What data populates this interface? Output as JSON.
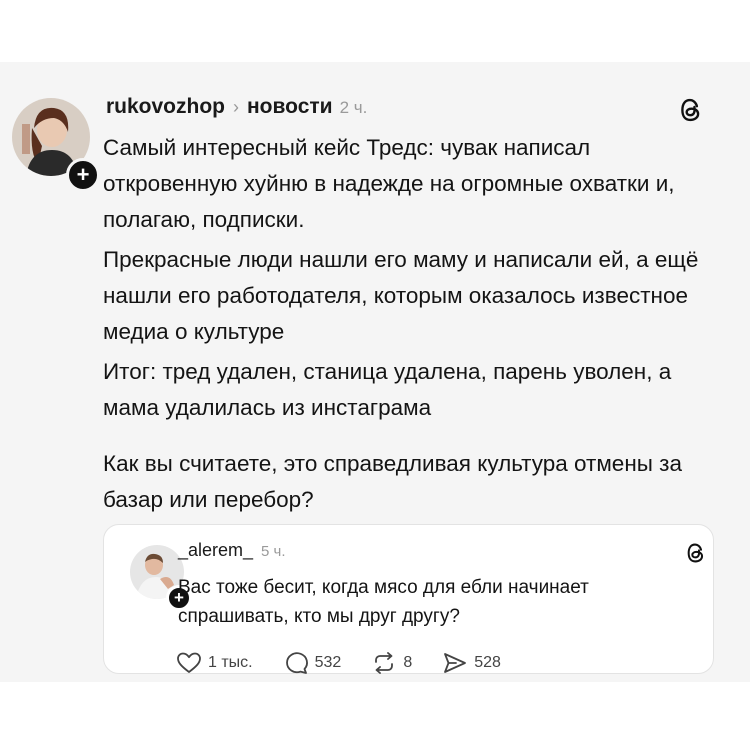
{
  "post": {
    "username": "rukovozhop",
    "topic": "новости",
    "time": "2 ч.",
    "paragraphs": [
      "Самый интересный кейс Тредс: чувак написал откровенную хуйню в надежде на огромные охватки и, полагаю, подписки.",
      "Прекрасные люди нашли его маму и написали ей, а ещё нашли его работодателя, которым оказалось известное медиа о культуре",
      "Итог: тред удален, станица удалена, парень уволен, а мама удалилась из инстаграма",
      "Как вы считаете, это справедливая культура отмены за базар или перебор?"
    ]
  },
  "quote": {
    "username": "_alerem_",
    "time": "5 ч.",
    "text": "Вас тоже бесит, когда мясо для ебли начинает спрашивать, кто мы друг другу?",
    "actions": {
      "likes": "1 тыс.",
      "replies": "532",
      "reposts": "8",
      "shares": "528"
    }
  },
  "icons": [
    "threads-logo-icon",
    "plus-icon",
    "heart-icon",
    "comment-icon",
    "repost-icon",
    "share-icon"
  ],
  "colors": {
    "card_background": "#f5f5f5",
    "quote_background": "#ffffff",
    "meta_gray": "#9a9a9a"
  }
}
